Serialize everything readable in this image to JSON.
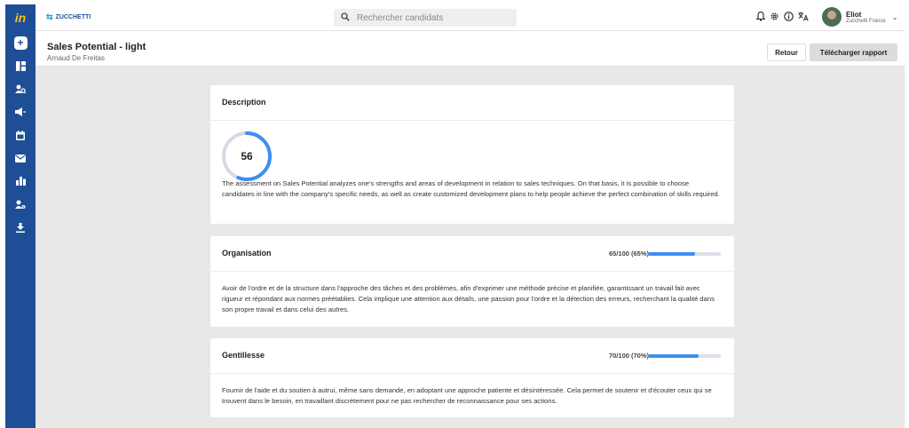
{
  "app": {
    "logo_text": "in",
    "brand": "ZUCCHETTI"
  },
  "search": {
    "placeholder": "Rechercher candidats"
  },
  "user": {
    "name": "Eliot",
    "org": "Zucchetti France"
  },
  "header": {
    "title": "Sales Potential - light",
    "subtitle": "Arnaud De Freitas",
    "back_label": "Retour",
    "download_label": "Télécharger rapport"
  },
  "description": {
    "title": "Description",
    "score": "56",
    "score_fraction": 0.56,
    "text": "The assessment on Sales Potential analyzes one's strengths and areas of development in relation to sales techniques. On that basis, it is possible to choose candidates in line with the company's specific needs, as well as create customized development plans to help people achieve the perfect combination of skills required."
  },
  "sections": [
    {
      "title": "Organisation",
      "score_text": "65/100 (65%)",
      "percent": 65,
      "text": "Avoir de l'ordre et de la structure dans l'approche des tâches et des problèmes, afin d'exprimer une méthode précise et planifiée, garantissant un travail fait avec rigueur et répondant aux normes préétablies. Cela implique une attention aux détails, une passion pour l'ordre et la détection des erreurs, recherchant la qualité dans son propre travail et dans celui des autres."
    },
    {
      "title": "Gentillesse",
      "score_text": "70/100 (70%)",
      "percent": 70,
      "text": "Fournir de l'aide et du soutien à autrui, même sans demande, en adoptant une approche patiente et désintéressée. Cela permet de soutenir et d'écouter ceux qui se trouvent dans le besoin, en travaillant discrètement pour ne pas rechercher de reconnaissance pour ses actions."
    }
  ],
  "colors": {
    "sidebar": "#1e4f96",
    "accent": "#3d8ef0",
    "gauge_track": "#d5dbe5"
  },
  "sidebar_icons": [
    "add-icon",
    "dashboard-icon",
    "candidate-search-icon",
    "campaign-icon",
    "calendar-icon",
    "mail-icon",
    "stats-icon",
    "user-settings-icon",
    "download-icon"
  ]
}
